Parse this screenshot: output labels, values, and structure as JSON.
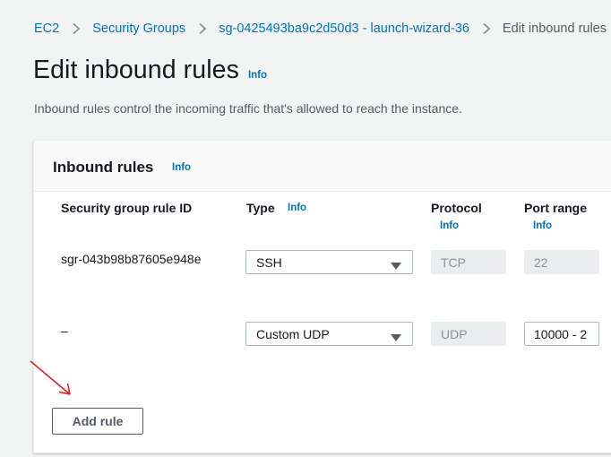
{
  "breadcrumb": {
    "items": [
      "EC2",
      "Security Groups",
      "sg-0425493ba9c2d50d3 - launch-wizard-36"
    ],
    "current": "Edit inbound rules"
  },
  "page": {
    "title": "Edit inbound rules",
    "title_info": "Info",
    "description": "Inbound rules control the incoming traffic that's allowed to reach the instance."
  },
  "panel": {
    "title": "Inbound rules",
    "info": "Info",
    "columns": {
      "rule_id": "Security group rule ID",
      "type": "Type",
      "type_info": "Info",
      "protocol": "Protocol",
      "protocol_info": "Info",
      "port_range": "Port range",
      "port_range_info": "Info"
    },
    "rows": [
      {
        "rule_id": "sgr-043b98b87605e948e",
        "type": "SSH",
        "protocol": "TCP",
        "port_range": "22"
      },
      {
        "rule_id": "–",
        "type": "Custom UDP",
        "protocol": "UDP",
        "port_range": "10000 - 2"
      }
    ],
    "add_rule_label": "Add rule"
  },
  "colors": {
    "link": "#0073bb",
    "annotation_arrow": "#e02020",
    "background": "#f2f3f3"
  }
}
